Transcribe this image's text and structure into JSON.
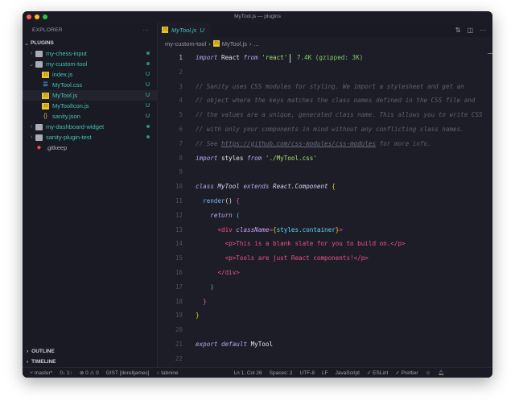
{
  "window_title": "MyTool.js — plugins",
  "sidebar": {
    "title": "EXPLORER",
    "more": "···",
    "root": "PLUGINS",
    "items": [
      {
        "label": "my-chess-input",
        "type": "folder",
        "badge": "dot",
        "expanded": false
      },
      {
        "label": "my-custom-tool",
        "type": "folder",
        "badge": "dot",
        "expanded": true
      },
      {
        "label": "index.js",
        "type": "js",
        "badge": "U"
      },
      {
        "label": "MyTool.css",
        "type": "css",
        "badge": "U"
      },
      {
        "label": "MyTool.js",
        "type": "js",
        "badge": "U",
        "selected": true
      },
      {
        "label": "MyToolIcon.js",
        "type": "js",
        "badge": "U"
      },
      {
        "label": "sanity.json",
        "type": "json",
        "badge": "U"
      },
      {
        "label": "my-dashboard-widget",
        "type": "folder",
        "badge": "dot",
        "expanded": false
      },
      {
        "label": "sanity-plugin-test",
        "type": "folder",
        "badge": "dot",
        "expanded": false
      },
      {
        "label": ".gitkeep",
        "type": "git",
        "badge": ""
      }
    ],
    "outline": "OUTLINE",
    "timeline": "TIMELINE"
  },
  "tab": {
    "label": "MyTool.js",
    "status": "U"
  },
  "breadcrumb": [
    "my-custom-tool",
    "MyTool.js",
    "..."
  ],
  "editor": {
    "current_line": 1,
    "lines": [
      [
        [
          "import",
          "kw"
        ],
        [
          " React ",
          ""
        ],
        [
          "from",
          "kw"
        ],
        [
          " ",
          ""
        ],
        [
          "'react'",
          "str"
        ],
        [
          "|",
          "cursor"
        ],
        [
          " 7.4K (gzipped: 3K)",
          "hint"
        ]
      ],
      [],
      [
        [
          "// Sanity uses CSS modules for styling. We import a stylesheet and get an",
          "cm"
        ]
      ],
      [
        [
          "// object where the keys matches the class names defined in the CSS file and",
          "cm"
        ]
      ],
      [
        [
          "// the values are a unique, generated class name. This allows you to write CSS",
          "cm"
        ]
      ],
      [
        [
          "// with only your components in mind without any conflicting class names.",
          "cm"
        ]
      ],
      [
        [
          "// See ",
          "cm"
        ],
        [
          "https://github.com/css-modules/css-modules",
          "lnk"
        ],
        [
          " for more info.",
          "cm"
        ]
      ],
      [
        [
          "import",
          "kw"
        ],
        [
          " styles ",
          ""
        ],
        [
          "from",
          "kw"
        ],
        [
          " ",
          ""
        ],
        [
          "'./MyTool.css'",
          "str"
        ]
      ],
      [],
      [
        [
          "class",
          "kw"
        ],
        [
          " ",
          ""
        ],
        [
          "MyTool",
          "cls"
        ],
        [
          " ",
          ""
        ],
        [
          "extends",
          "kw"
        ],
        [
          " ",
          ""
        ],
        [
          "React.Component",
          "cls"
        ],
        [
          " ",
          ""
        ],
        [
          "{",
          "br1"
        ]
      ],
      [
        [
          "  ",
          ""
        ],
        [
          "render",
          "fn"
        ],
        [
          "() ",
          ""
        ],
        [
          "{",
          "br2"
        ]
      ],
      [
        [
          "    ",
          ""
        ],
        [
          "return",
          "kw"
        ],
        [
          " ",
          ""
        ],
        [
          "(",
          "br3"
        ]
      ],
      [
        [
          "      ",
          ""
        ],
        [
          "<div ",
          "tag"
        ],
        [
          "className",
          "attr"
        ],
        [
          "=",
          "tag"
        ],
        [
          "{",
          "br1"
        ],
        [
          "styles.",
          "prop"
        ],
        [
          "container",
          "prop"
        ],
        [
          "}",
          "br1"
        ],
        [
          ">",
          "tag"
        ]
      ],
      [
        [
          "        ",
          ""
        ],
        [
          "<p>This is a blank slate for you to build on.</p>",
          "tag"
        ]
      ],
      [
        [
          "        ",
          ""
        ],
        [
          "<p>Tools are just React components!</p>",
          "tag"
        ]
      ],
      [
        [
          "      ",
          ""
        ],
        [
          "</div>",
          "tag"
        ]
      ],
      [
        [
          "    ",
          ""
        ],
        [
          ")",
          "br3"
        ]
      ],
      [
        [
          "  ",
          ""
        ],
        [
          "}",
          "br2"
        ]
      ],
      [
        [
          "}",
          "br1"
        ]
      ],
      [],
      [
        [
          "export",
          "kw"
        ],
        [
          " ",
          ""
        ],
        [
          "default",
          "kw"
        ],
        [
          " MyTool",
          ""
        ]
      ],
      []
    ]
  },
  "statusbar": [
    "master*",
    "0↓ 1↑",
    "⊗ 0 ⚠ 0",
    "GIST [dorelljames]",
    "○ tabnine",
    "Ln 1, Col 26",
    "Spaces: 2",
    "UTF-8",
    "LF",
    "JavaScript",
    "✓ ESLint",
    "✓ Prettier"
  ],
  "colors": {
    "accent": "#3fc5b5",
    "editor_bg": "#1c1d27",
    "sidebar_bg": "#191a23"
  }
}
